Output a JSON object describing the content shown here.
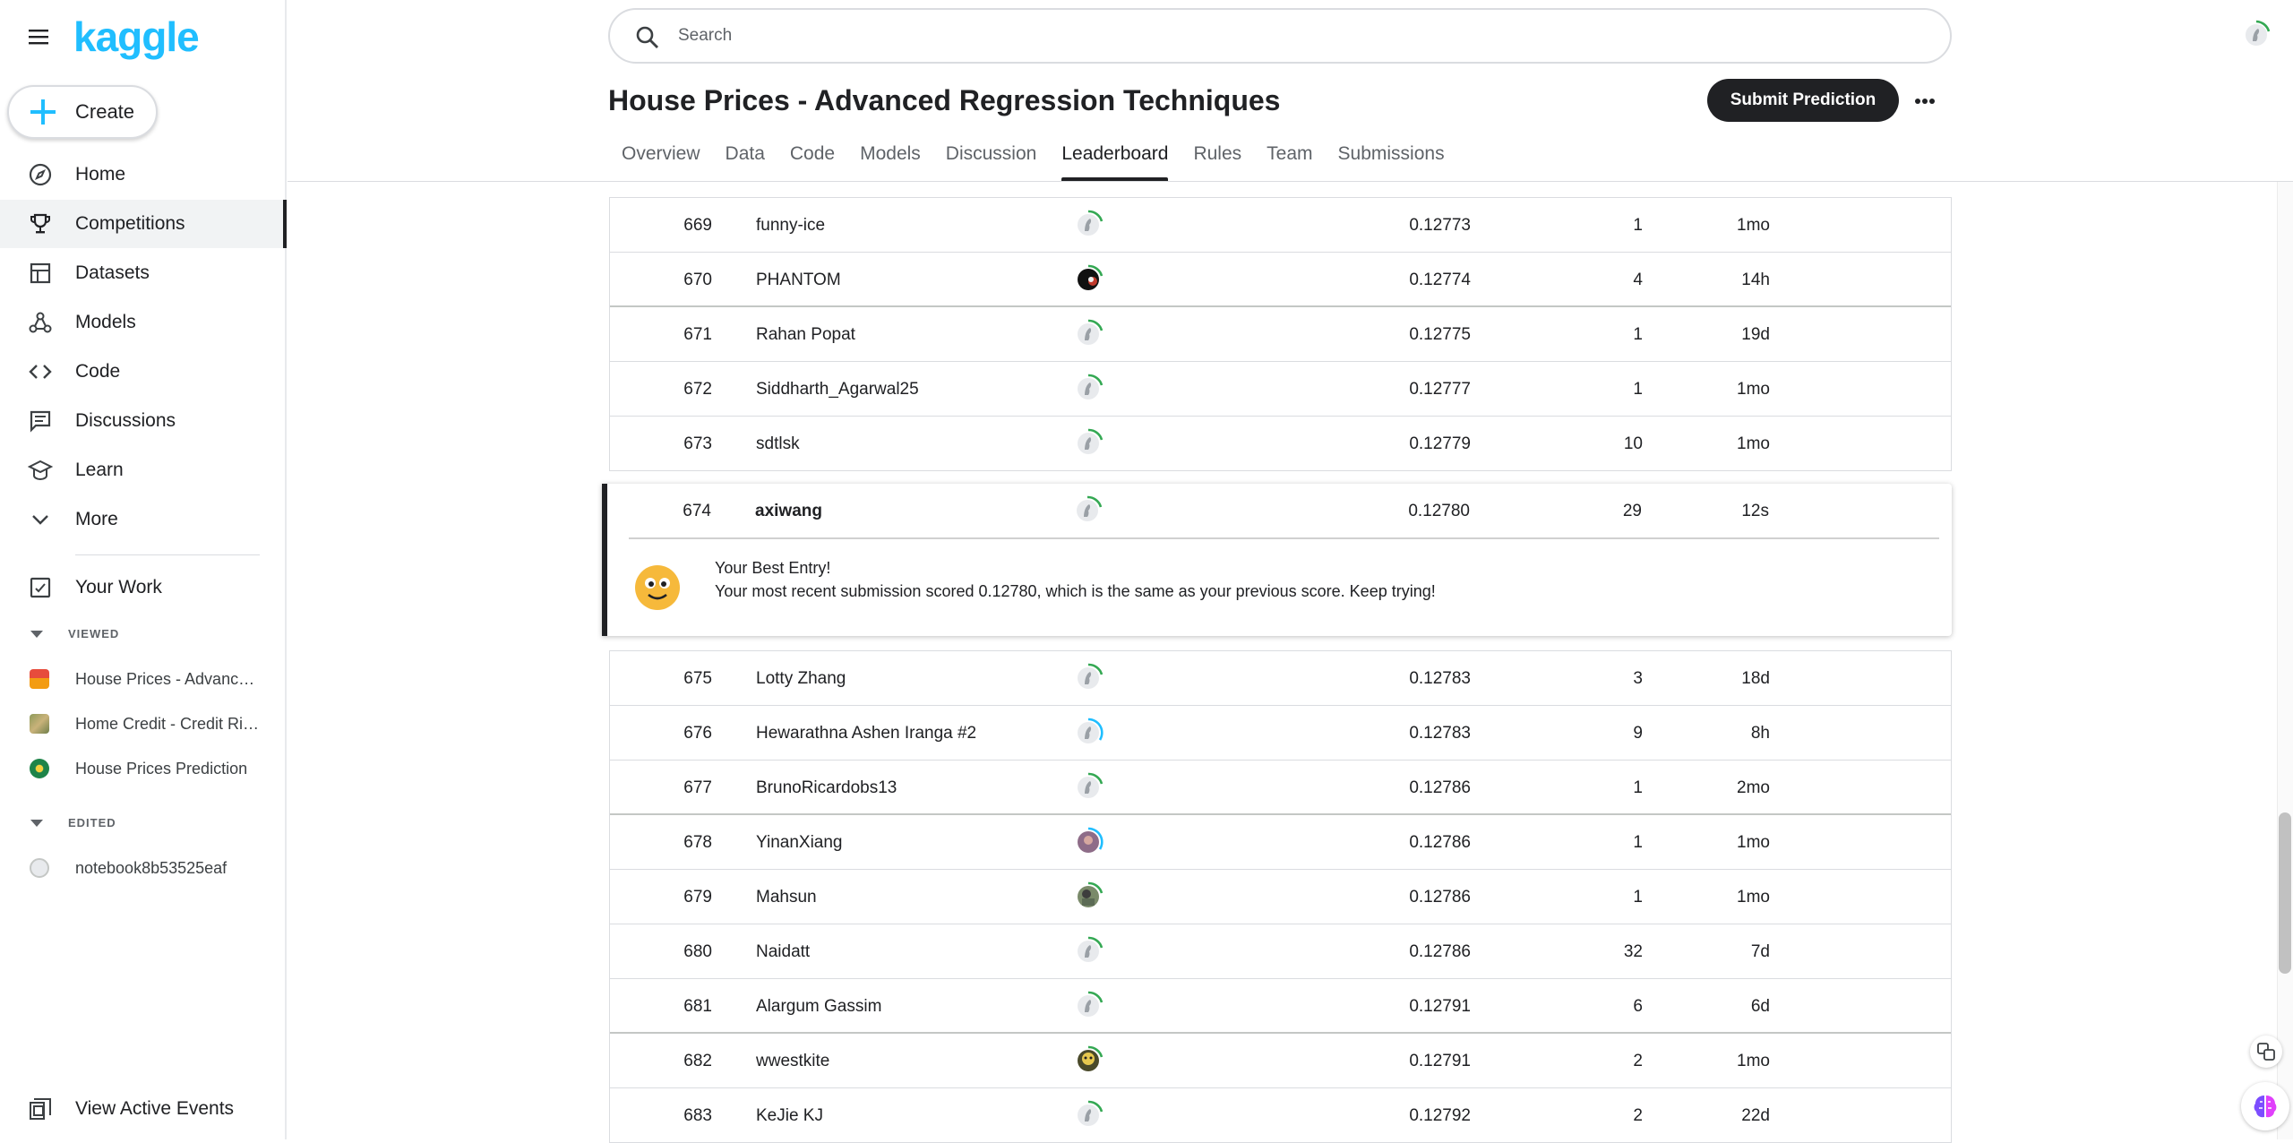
{
  "app": {
    "logo": "kaggle"
  },
  "sidebar": {
    "create_label": "Create",
    "nav": [
      {
        "label": "Home",
        "icon": "compass-icon"
      },
      {
        "label": "Competitions",
        "icon": "trophy-icon",
        "active": true
      },
      {
        "label": "Datasets",
        "icon": "table-icon"
      },
      {
        "label": "Models",
        "icon": "models-icon"
      },
      {
        "label": "Code",
        "icon": "code-icon"
      },
      {
        "label": "Discussions",
        "icon": "comments-icon"
      },
      {
        "label": "Learn",
        "icon": "school-icon"
      },
      {
        "label": "More",
        "icon": "chevron-down-icon"
      }
    ],
    "your_work": "Your Work",
    "viewed_header": "VIEWED",
    "viewed": [
      {
        "label": "House Prices - Advanced Regression Techniques"
      },
      {
        "label": "Home Credit - Credit Risk Model Stability"
      },
      {
        "label": "House Prices Prediction"
      }
    ],
    "edited_header": "EDITED",
    "edited": [
      {
        "label": "notebook8b53525eaf"
      }
    ],
    "active_events": "View Active Events"
  },
  "search": {
    "placeholder": "Search"
  },
  "competition": {
    "title": "House Prices - Advanced Regression Techniques",
    "submit_label": "Submit Prediction",
    "tabs": [
      "Overview",
      "Data",
      "Code",
      "Models",
      "Discussion",
      "Leaderboard",
      "Rules",
      "Team",
      "Submissions"
    ],
    "active_tab": "Leaderboard"
  },
  "leaderboard": {
    "rows_before": [
      {
        "rank": "669",
        "name": "funny-ice",
        "score": "0.12773",
        "entries": "1",
        "last": "1mo",
        "ring": "#34a853"
      },
      {
        "rank": "670",
        "name": "PHANTOM",
        "score": "0.12774",
        "entries": "4",
        "last": "14h",
        "ring": "#34a853",
        "avatar": "dark"
      },
      {
        "rank": "671",
        "name": "Rahan Popat",
        "score": "0.12775",
        "entries": "1",
        "last": "19d",
        "ring": "#34a853"
      },
      {
        "rank": "672",
        "name": "Siddharth_Agarwal25",
        "score": "0.12777",
        "entries": "1",
        "last": "1mo",
        "ring": "#34a853"
      },
      {
        "rank": "673",
        "name": "sdtlsk",
        "score": "0.12779",
        "entries": "10",
        "last": "1mo",
        "ring": "#34a853"
      }
    ],
    "best": {
      "rank": "674",
      "name": "axiwang",
      "score": "0.12780",
      "entries": "29",
      "last": "12s",
      "title": "Your Best Entry!",
      "message": "Your most recent submission scored 0.12780, which is the same as your previous score. Keep trying!"
    },
    "rows_after": [
      {
        "rank": "675",
        "name": "Lotty Zhang",
        "score": "0.12783",
        "entries": "3",
        "last": "18d",
        "ring": "#34a853"
      },
      {
        "rank": "676",
        "name": "Hewarathna Ashen Iranga #2",
        "score": "0.12783",
        "entries": "9",
        "last": "8h",
        "ring": "#20beff"
      },
      {
        "rank": "677",
        "name": "BrunoRicardobs13",
        "score": "0.12786",
        "entries": "1",
        "last": "2mo",
        "ring": "#34a853"
      },
      {
        "rank": "678",
        "name": "YinanXiang",
        "score": "0.12786",
        "entries": "1",
        "last": "1mo",
        "ring": "#20beff",
        "avatar": "photo"
      },
      {
        "rank": "679",
        "name": "Mahsun",
        "score": "0.12786",
        "entries": "1",
        "last": "1mo",
        "ring": "#34a853",
        "avatar": "photo2"
      },
      {
        "rank": "680",
        "name": "Naidatt",
        "score": "0.12786",
        "entries": "32",
        "last": "7d",
        "ring": "#34a853"
      },
      {
        "rank": "681",
        "name": "Alargum Gassim",
        "score": "0.12791",
        "entries": "6",
        "last": "6d",
        "ring": "#34a853"
      },
      {
        "rank": "682",
        "name": "wwestkite",
        "score": "0.12791",
        "entries": "2",
        "last": "1mo",
        "ring": "#34a853",
        "avatar": "cat"
      },
      {
        "rank": "683",
        "name": "KeJie KJ",
        "score": "0.12792",
        "entries": "2",
        "last": "22d",
        "ring": "#34a853"
      }
    ]
  },
  "colors": {
    "brand": "#20beff",
    "ink": "#202124",
    "tier_green": "#34a853",
    "tier_blue": "#20beff"
  }
}
